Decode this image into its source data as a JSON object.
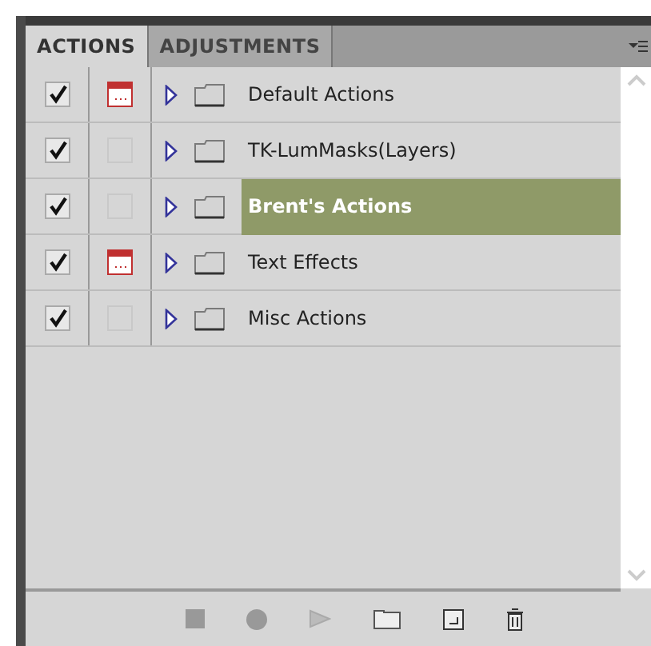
{
  "tabs": [
    {
      "label": "ACTIONS",
      "selected": true
    },
    {
      "label": "ADJUSTMENTS",
      "selected": false
    }
  ],
  "actions": [
    {
      "name": "Default Actions",
      "checked": true,
      "dialog": true,
      "selected": false
    },
    {
      "name": "TK-LumMasks(Layers)",
      "checked": true,
      "dialog": false,
      "selected": false
    },
    {
      "name": "Brent's Actions",
      "checked": true,
      "dialog": false,
      "selected": true
    },
    {
      "name": "Text Effects",
      "checked": true,
      "dialog": true,
      "selected": false
    },
    {
      "name": "Misc Actions",
      "checked": true,
      "dialog": false,
      "selected": false
    }
  ]
}
